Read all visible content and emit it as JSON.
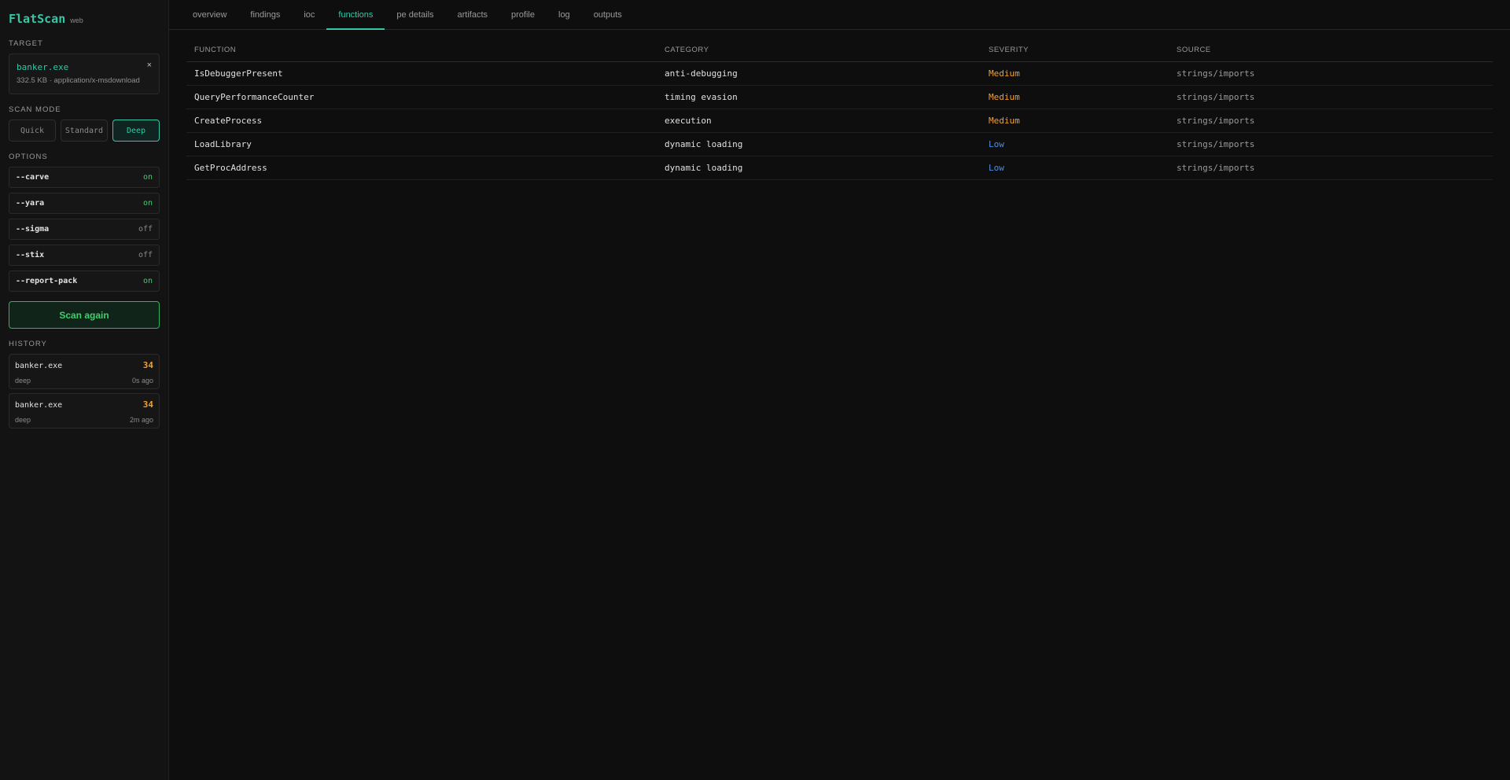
{
  "app": {
    "name": "FlatScan",
    "tag": "web"
  },
  "sidebar": {
    "target_label": "TARGET",
    "target": {
      "name": "banker.exe",
      "meta": "332.5 KB · application/x-msdownload",
      "close": "×"
    },
    "scan_mode_label": "SCAN MODE",
    "modes": [
      "Quick",
      "Standard",
      "Deep"
    ],
    "active_mode": "Deep",
    "options_label": "OPTIONS",
    "options": [
      {
        "name": "--carve",
        "value": "on"
      },
      {
        "name": "--yara",
        "value": "on"
      },
      {
        "name": "--sigma",
        "value": "off"
      },
      {
        "name": "--stix",
        "value": "off"
      },
      {
        "name": "--report-pack",
        "value": "on"
      }
    ],
    "scan_button": "Scan again",
    "history_label": "HISTORY",
    "history": [
      {
        "name": "banker.exe",
        "score": "34",
        "mode": "deep",
        "time": "0s ago"
      },
      {
        "name": "banker.exe",
        "score": "34",
        "mode": "deep",
        "time": "2m ago"
      }
    ]
  },
  "tabs": [
    "overview",
    "findings",
    "ioc",
    "functions",
    "pe details",
    "artifacts",
    "profile",
    "log",
    "outputs"
  ],
  "active_tab": "functions",
  "table": {
    "headers": [
      "FUNCTION",
      "CATEGORY",
      "SEVERITY",
      "SOURCE"
    ],
    "rows": [
      {
        "function": "IsDebuggerPresent",
        "category": "anti-debugging",
        "severity": "Medium",
        "source": "strings/imports"
      },
      {
        "function": "QueryPerformanceCounter",
        "category": "timing evasion",
        "severity": "Medium",
        "source": "strings/imports"
      },
      {
        "function": "CreateProcess",
        "category": "execution",
        "severity": "Medium",
        "source": "strings/imports"
      },
      {
        "function": "LoadLibrary",
        "category": "dynamic loading",
        "severity": "Low",
        "source": "strings/imports"
      },
      {
        "function": "GetProcAddress",
        "category": "dynamic loading",
        "severity": "Low",
        "source": "strings/imports"
      }
    ]
  },
  "colors": {
    "accent": "#35c6a6",
    "on": "#3ed06a",
    "medium": "#f0a030",
    "low": "#4a90e2"
  }
}
